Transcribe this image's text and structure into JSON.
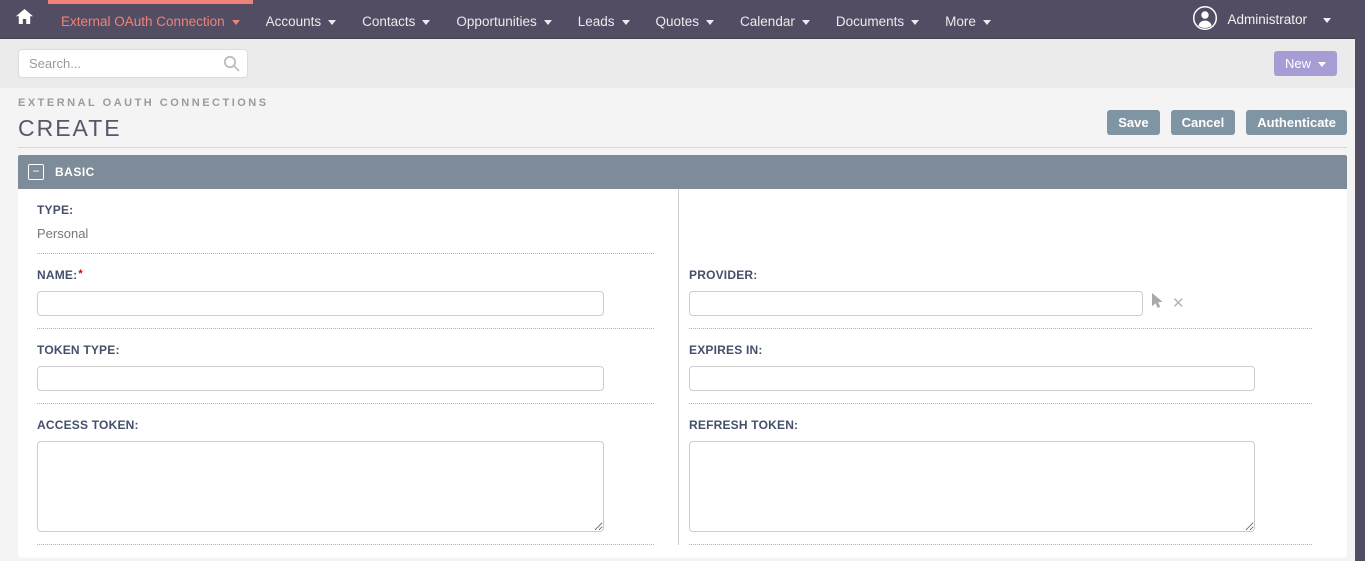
{
  "nav": {
    "active_item": {
      "label": "External OAuth Connection"
    },
    "items": [
      {
        "label": "Accounts"
      },
      {
        "label": "Contacts"
      },
      {
        "label": "Opportunities"
      },
      {
        "label": "Leads"
      },
      {
        "label": "Quotes"
      },
      {
        "label": "Calendar"
      },
      {
        "label": "Documents"
      },
      {
        "label": "More"
      }
    ],
    "user": {
      "name": "Administrator"
    }
  },
  "topbar": {
    "search_placeholder": "Search...",
    "new_button": "New"
  },
  "header": {
    "module": "EXTERNAL OAUTH CONNECTIONS",
    "title": "CREATE",
    "actions": [
      "Save",
      "Cancel",
      "Authenticate"
    ]
  },
  "panel": {
    "title": "BASIC",
    "collapse_glyph": "−"
  },
  "form": {
    "type": {
      "label": "TYPE:",
      "value": "Personal"
    },
    "name": {
      "label": "NAME:",
      "required": "*",
      "value": ""
    },
    "provider": {
      "label": "PROVIDER:",
      "value": ""
    },
    "token_type": {
      "label": "TOKEN TYPE:",
      "value": ""
    },
    "expires_in": {
      "label": "EXPIRES IN:",
      "value": ""
    },
    "access_token": {
      "label": "ACCESS TOKEN:",
      "value": ""
    },
    "refresh_token": {
      "label": "REFRESH TOKEN:",
      "value": ""
    }
  },
  "colors": {
    "navbar_bg": "#534d64",
    "accent_salmon": "#f08377",
    "new_button_bg": "#a79cd4",
    "action_button_bg": "#8095a4",
    "panel_header_bg": "#7d8c98",
    "label_color": "#44506b",
    "required_color": "#d40000"
  }
}
